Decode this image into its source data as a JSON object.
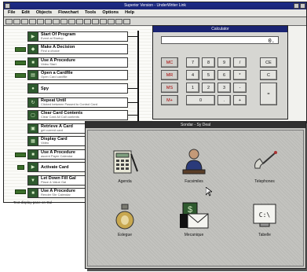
{
  "main_window": {
    "title": "Superior Version - UnderWriter Link",
    "menu": [
      "File",
      "Edit",
      "Objects",
      "Flowchart",
      "Tools",
      "Options",
      "Help"
    ]
  },
  "flowchart": {
    "steps": [
      {
        "title": "Start Of Program",
        "sub": "Event at Startup"
      },
      {
        "title": "Make A Decision",
        "sub": "Find a choice"
      },
      {
        "title": "Use A Procedure",
        "sub": "Video Start"
      },
      {
        "title": "Open a Cardfile",
        "sub": "Open Card cardfile"
      },
      {
        "title": "Spy",
        "sub": ""
      },
      {
        "title": "Repeat Until",
        "sub": "Clicked between Passed to Control Card"
      },
      {
        "title": "Clear Card Contents",
        "sub": "Clear Card All Call contents"
      },
      {
        "title": "Retrieve A Card",
        "sub": "get current card"
      },
      {
        "title": "Display Card",
        "sub": "Video"
      },
      {
        "title": "Use A Procedure",
        "sub": "ascent Payer Calendar"
      },
      {
        "title": "Activate Card",
        "sub": ""
      },
      {
        "title": "Let Down Fill Gal",
        "sub": "Place & Value Gal"
      },
      {
        "title": "Use A Procedure",
        "sub": "Render Shr Calendar"
      }
    ],
    "status_text": "Text display pane on Gul"
  },
  "calculator": {
    "title": "Calculator",
    "display": "0.",
    "keys": {
      "mc": "MC",
      "mr": "MR",
      "ms": "MS",
      "mplus": "M+",
      "n7": "7",
      "n8": "8",
      "n9": "9",
      "div": "/",
      "ce": "CE",
      "n4": "4",
      "n5": "5",
      "n6": "6",
      "mul": "*",
      "c": "C",
      "n1": "1",
      "n2": "2",
      "n3": "3",
      "minus": "-",
      "n0": "0",
      "dot": ".",
      "plus": "+",
      "eq": "="
    }
  },
  "launcher": {
    "title": "Sondar - Sy Deal",
    "apps": [
      {
        "label": "Agenda",
        "icon": "calculator-notepad-icon"
      },
      {
        "label": "Facsimiles",
        "icon": "person-at-desk-icon"
      },
      {
        "label": "Telephones",
        "icon": "handset-icon"
      },
      {
        "label": "Eslegue",
        "icon": "perfume-bottle-icon"
      },
      {
        "label": "Mecanique",
        "icon": "envelope-money-icon"
      },
      {
        "label": "Tabelle",
        "icon": "monitor-icon"
      }
    ]
  }
}
